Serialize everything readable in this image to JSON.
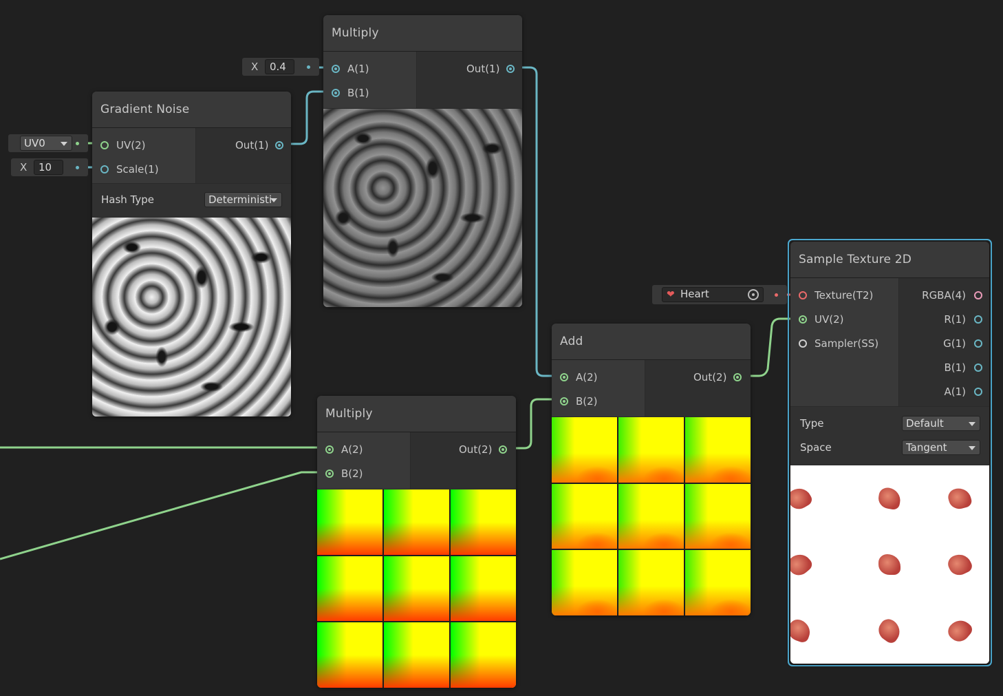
{
  "nodes": {
    "gradient_noise": {
      "title": "Gradient Noise",
      "inputs": [
        "UV(2)",
        "Scale(1)"
      ],
      "output": "Out(1)",
      "hash_type_label": "Hash Type",
      "hash_type_value": "Deterministi"
    },
    "multiply_top": {
      "title": "Multiply",
      "inputs": [
        "A(1)",
        "B(1)"
      ],
      "output": "Out(1)"
    },
    "multiply_bottom": {
      "title": "Multiply",
      "inputs": [
        "A(2)",
        "B(2)"
      ],
      "output": "Out(2)"
    },
    "add": {
      "title": "Add",
      "inputs": [
        "A(2)",
        "B(2)"
      ],
      "output": "Out(2)"
    },
    "sample_texture_2d": {
      "title": "Sample Texture 2D",
      "inputs": [
        "Texture(T2)",
        "UV(2)",
        "Sampler(SS)"
      ],
      "outputs": [
        "RGBA(4)",
        "R(1)",
        "G(1)",
        "B(1)",
        "A(1)"
      ],
      "type_label": "Type",
      "type_value": "Default",
      "space_label": "Space",
      "space_value": "Tangent"
    }
  },
  "inline_fields": {
    "uv_channel": "UV0",
    "scale_label": "X",
    "scale_value": "10",
    "multiply_a_label": "X",
    "multiply_a_value": "0.4",
    "texture_name": "Heart"
  },
  "icons": {
    "texture_thumb": "heart-icon",
    "object_picker": "target-icon",
    "dropdown": "chevron-down-icon"
  },
  "colors": {
    "float_port": "#6ab6c4",
    "vector2_port": "#8fd38c",
    "vector4_port": "#e99bb8",
    "texture_port": "#ea6a6a",
    "selection": "#4fb0d8"
  }
}
